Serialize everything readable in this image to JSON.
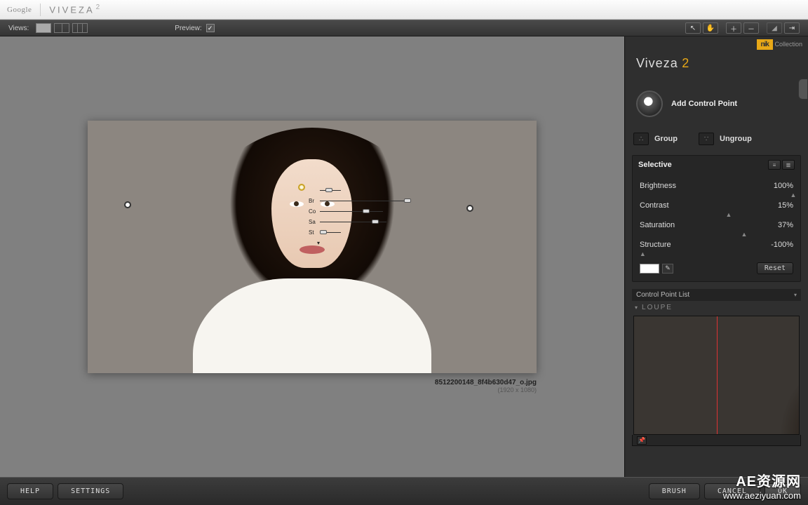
{
  "titlebar": {
    "google": "Google",
    "app": "VIVEZA",
    "version": "2"
  },
  "toolbar": {
    "views_label": "Views:",
    "preview_label": "Preview:",
    "preview_checked": "✓"
  },
  "canvas": {
    "filename": "8512200148_8f4b630d47_o.jpg",
    "dimensions": "(1920 x 1080)",
    "control_point": {
      "rows": [
        {
          "label": "Br",
          "track_w": 120,
          "knob_pct": 100
        },
        {
          "label": "Co",
          "track_w": 90,
          "knob_pct": 68
        },
        {
          "label": "Sa",
          "track_w": 95,
          "knob_pct": 78
        },
        {
          "label": "St",
          "track_w": 30,
          "knob_pct": 0
        }
      ],
      "size_knob_pct": 25
    }
  },
  "sidebar": {
    "nik_label": "Collection",
    "nik_logo": "nik",
    "title": "Viveza",
    "title_suffix": "2",
    "add_cp": "Add Control Point",
    "group": "Group",
    "ungroup": "Ungroup",
    "panel_title": "Selective",
    "sliders": [
      {
        "name": "Brightness",
        "value": "100%",
        "mark": 100
      },
      {
        "name": "Contrast",
        "value": "15%",
        "mark": 58
      },
      {
        "name": "Saturation",
        "value": "37%",
        "mark": 68
      },
      {
        "name": "Structure",
        "value": "-100%",
        "mark": 2
      }
    ],
    "reset": "Reset",
    "cpl": "Control Point List",
    "loupe": "LOUPE"
  },
  "bottombar": {
    "help": "HELP",
    "settings": "SETTINGS",
    "brush": "BRUSH",
    "cancel": "CANCEL",
    "ok": "OK"
  },
  "watermark": {
    "cn": "AE资源网",
    "url": "www.aeziyuan.com"
  }
}
